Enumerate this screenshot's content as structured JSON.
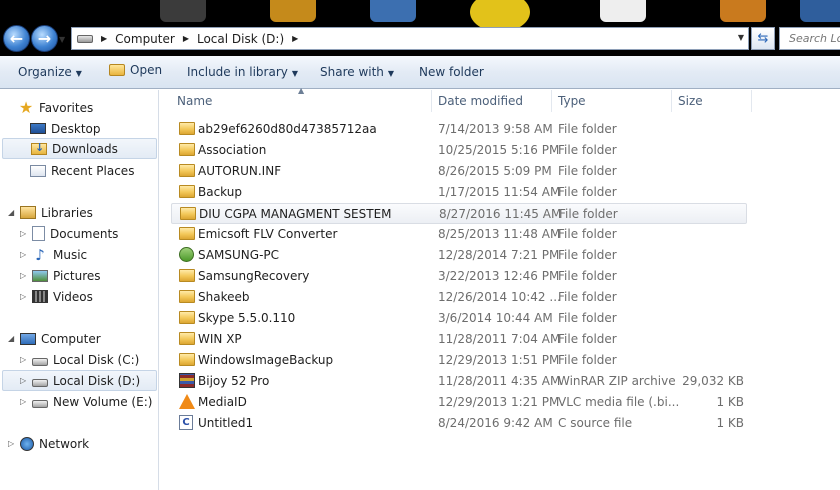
{
  "address": {
    "breadcrumbs": [
      "Computer",
      "Local Disk (D:)"
    ],
    "search_placeholder": "Search Lo"
  },
  "toolbar": {
    "organize": "Organize",
    "open": "Open",
    "include_in_library": "Include in library",
    "share_with": "Share with",
    "new_folder": "New folder"
  },
  "nav": {
    "favorites": {
      "label": "Favorites",
      "items": [
        "Desktop",
        "Downloads",
        "Recent Places"
      ],
      "selected": "Downloads"
    },
    "libraries": {
      "label": "Libraries",
      "items": [
        "Documents",
        "Music",
        "Pictures",
        "Videos"
      ]
    },
    "computer": {
      "label": "Computer",
      "items": [
        "Local Disk (C:)",
        "Local Disk (D:)",
        "New Volume (E:)"
      ],
      "selected": "Local Disk (D:)"
    },
    "network": {
      "label": "Network"
    }
  },
  "columns": {
    "name": "Name",
    "date": "Date modified",
    "type": "Type",
    "size": "Size"
  },
  "files": [
    {
      "name": "ab29ef6260d80d47385712aa",
      "date": "7/14/2013 9:58 AM",
      "type": "File folder",
      "size": "",
      "icon": "folder-icon"
    },
    {
      "name": "Association",
      "date": "10/25/2015 5:16 PM",
      "type": "File folder",
      "size": "",
      "icon": "folder-icon"
    },
    {
      "name": "AUTORUN.INF",
      "date": "8/26/2015 5:09 PM",
      "type": "File folder",
      "size": "",
      "icon": "folder-icon"
    },
    {
      "name": "Backup",
      "date": "1/17/2015 11:54 AM",
      "type": "File folder",
      "size": "",
      "icon": "folder-icon"
    },
    {
      "name": "DIU CGPA MANAGMENT SESTEM",
      "date": "8/27/2016 11:45 AM",
      "type": "File folder",
      "size": "",
      "icon": "folder-icon",
      "hover": true
    },
    {
      "name": "Emicsoft FLV Converter",
      "date": "8/25/2013 11:48 AM",
      "type": "File folder",
      "size": "",
      "icon": "folder-icon"
    },
    {
      "name": "SAMSUNG-PC",
      "date": "12/28/2014 7:21 PM",
      "type": "File folder",
      "size": "",
      "icon": "network-pc-icon"
    },
    {
      "name": "SamsungRecovery",
      "date": "3/22/2013 12:46 PM",
      "type": "File folder",
      "size": "",
      "icon": "folder-icon"
    },
    {
      "name": "Shakeeb",
      "date": "12/26/2014 10:42 ...",
      "type": "File folder",
      "size": "",
      "icon": "folder-icon"
    },
    {
      "name": "Skype 5.5.0.110",
      "date": "3/6/2014 10:44 AM",
      "type": "File folder",
      "size": "",
      "icon": "folder-icon"
    },
    {
      "name": "WIN XP",
      "date": "11/28/2011 7:04 AM",
      "type": "File folder",
      "size": "",
      "icon": "folder-icon"
    },
    {
      "name": "WindowsImageBackup",
      "date": "12/29/2013 1:51 PM",
      "type": "File folder",
      "size": "",
      "icon": "folder-icon"
    },
    {
      "name": "Bijoy 52 Pro",
      "date": "11/28/2011 4:35 AM",
      "type": "WinRAR ZIP archive",
      "size": "29,032 KB",
      "icon": "winrar-icon"
    },
    {
      "name": "MediaID",
      "date": "12/29/2013 1:21 PM",
      "type": "VLC media file (.bi...",
      "size": "1 KB",
      "icon": "vlc-icon"
    },
    {
      "name": "Untitled1",
      "date": "8/24/2016 9:42 AM",
      "type": "C source file",
      "size": "1 KB",
      "icon": "c-source-icon"
    }
  ]
}
